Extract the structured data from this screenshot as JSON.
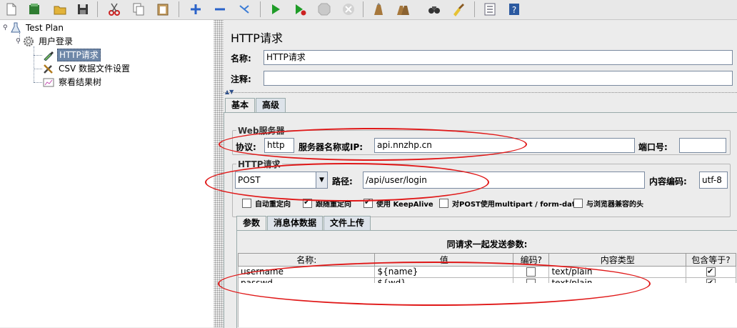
{
  "tree": {
    "test_plan": "Test Plan",
    "thread_group": "用户登录",
    "http_request": "HTTP请求",
    "csv_config": "CSV 数据文件设置",
    "results_tree": "察看结果树"
  },
  "panel": {
    "title": "HTTP请求",
    "name_label": "名称:",
    "name_value": "HTTP请求",
    "comment_label": "注释:",
    "comment_value": ""
  },
  "main_tabs": [
    "基本",
    "高级"
  ],
  "web_server": {
    "group_title": "Web服务器",
    "protocol_label": "协议:",
    "protocol_value": "http",
    "server_label": "服务器名称或IP:",
    "server_value": "api.nnzhp.cn",
    "port_label": "端口号:",
    "port_value": ""
  },
  "http_request": {
    "group_title": "HTTP请求",
    "method_value": "POST",
    "path_label": "路径:",
    "path_value": "/api/user/login",
    "encoding_label": "内容编码:",
    "encoding_value": "utf-8"
  },
  "options": [
    {
      "label": "自动重定向",
      "checked": false
    },
    {
      "label": "跟随重定向",
      "checked": true
    },
    {
      "label": "使用 KeepAlive",
      "checked": true
    },
    {
      "label": "对POST使用multipart / form-data",
      "checked": false
    },
    {
      "label": "与浏览器兼容的头",
      "checked": false
    }
  ],
  "sub_tabs": [
    "参数",
    "消息体数据",
    "文件上传"
  ],
  "params": {
    "heading": "同请求一起发送参数:",
    "columns": [
      "名称:",
      "值",
      "编码?",
      "内容类型",
      "包含等于?"
    ],
    "rows": [
      {
        "name": "username",
        "value": "${name}",
        "encode": false,
        "content_type": "text/plain",
        "include_equals": true
      },
      {
        "name": "passwd",
        "value": "${wd}",
        "encode": false,
        "content_type": "text/plain",
        "include_equals": true
      }
    ]
  },
  "colors": {
    "selection": "#6e87a8",
    "annotation": "#e01818"
  }
}
